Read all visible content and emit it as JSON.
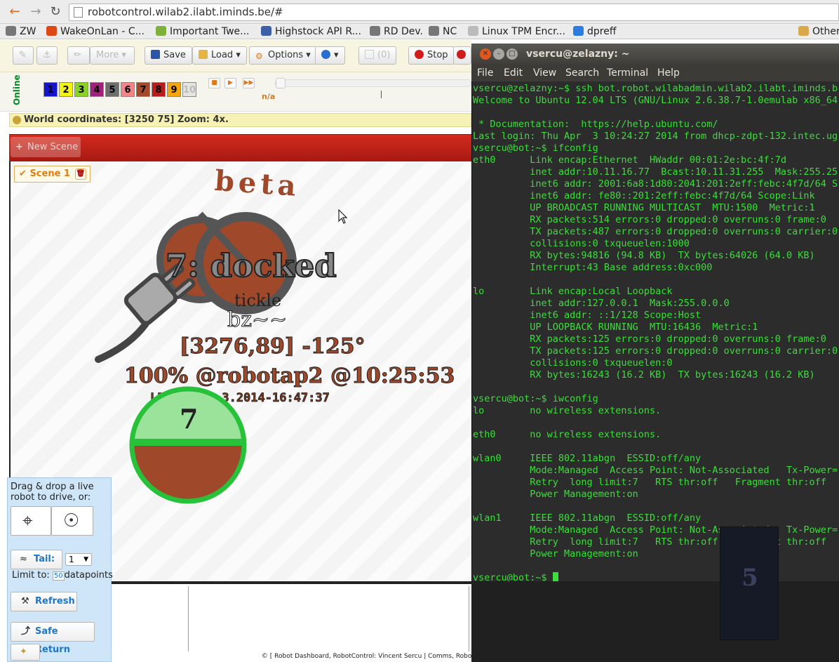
{
  "browser": {
    "url": "robotcontrol.wilab2.ilabt.iminds.be/#",
    "bookmarks": [
      {
        "label": "ZW",
        "color": "#777777"
      },
      {
        "label": "WakeOnLan - C...",
        "color": "#dd4814"
      },
      {
        "label": "Important Twe...",
        "color": "#7fb13a"
      },
      {
        "label": "Highstock API R...",
        "color": "#3c5fa8"
      },
      {
        "label": "RD Dev.",
        "color": "#777777"
      },
      {
        "label": "NC",
        "color": "#777777"
      },
      {
        "label": "Linux TPM Encr...",
        "color": "#bbbbbb"
      },
      {
        "label": "dpreff",
        "color": "#2a7de1"
      },
      {
        "label": "Other",
        "color": "#d9a84a"
      }
    ]
  },
  "toolbar": {
    "more": "More ▾",
    "save": "Save",
    "load": "Load ▾",
    "options": "Options ▾",
    "help": "▾",
    "count": "(0)",
    "stop": "Stop"
  },
  "online": {
    "label": "Online",
    "numbers": [
      {
        "n": "1",
        "bg": "#1414c8",
        "fg": "#000000"
      },
      {
        "n": "2",
        "bg": "#f2f214",
        "fg": "#000000"
      },
      {
        "n": "3",
        "bg": "#8ad126",
        "fg": "#000000"
      },
      {
        "n": "4",
        "bg": "#a0207a",
        "fg": "#000000"
      },
      {
        "n": "5",
        "bg": "#6d6d6d",
        "fg": "#000000"
      },
      {
        "n": "6",
        "bg": "#f28585",
        "fg": "#000000"
      },
      {
        "n": "7",
        "bg": "#a5492c",
        "fg": "#000000"
      },
      {
        "n": "8",
        "bg": "#b81c1c",
        "fg": "#000000"
      },
      {
        "n": "9",
        "bg": "#f5a50c",
        "fg": "#000000"
      },
      {
        "n": "10",
        "bg": "#e5e5df",
        "fg": "#bbbbbb"
      }
    ],
    "status": "n/a"
  },
  "coords": {
    "text": "World coordinates: [3250 75] Zoom: 4x."
  },
  "scene": {
    "new_scene": "New Scene",
    "tab": "Scene 1"
  },
  "robot": {
    "beta": "beta",
    "state": "7: docked",
    "tickle": "tickle",
    "bz": "bz~~",
    "position": "[3276,89]  -125°",
    "status": "100% @robotap2 @10:25:53",
    "lpe": "LPE v: 26.3.2014-16:47:37",
    "id": "7",
    "battery_pct": 100
  },
  "panel": {
    "drag_text": "Drag & drop a live robot to drive, or:",
    "tail": "Tail:",
    "tail_value": "1",
    "limit_prefix": "Limit to:",
    "limit_value": "50",
    "limit_suffix": "datapoints",
    "refresh": "Refresh",
    "safe_return": "Safe Return"
  },
  "footer": "© [ Robot Dashboard, RobotControl: Vincent Sercu | Comms, Robot Interface + LPE: Bart Jooris ]",
  "terminal": {
    "title": "vsercu@zelazny: ~",
    "menu": [
      "File",
      "Edit",
      "View",
      "Search",
      "Terminal",
      "Help"
    ],
    "lines": [
      "vsercu@zelazny:~$ ssh bot.robot.wilabadmin.wilab2.ilabt.iminds.b",
      "Welcome to Ubuntu 12.04 LTS (GNU/Linux 2.6.38.7-1.0emulab x86_64",
      "",
      " * Documentation:  https://help.ubuntu.com/",
      "Last login: Thu Apr  3 10:24:27 2014 from dhcp-zdpt-132.intec.ug",
      "vsercu@bot:~$ ifconfig",
      "eth0      Link encap:Ethernet  HWaddr 00:01:2e:bc:4f:7d",
      "          inet addr:10.11.16.77  Bcast:10.11.31.255  Mask:255.25",
      "          inet6 addr: 2001:6a8:1d80:2041:201:2eff:febc:4f7d/64 S",
      "          inet6 addr: fe80::201:2eff:febc:4f7d/64 Scope:Link",
      "          UP BROADCAST RUNNING MULTICAST  MTU:1500  Metric:1",
      "          RX packets:514 errors:0 dropped:0 overruns:0 frame:0",
      "          TX packets:487 errors:0 dropped:0 overruns:0 carrier:0",
      "          collisions:0 txqueuelen:1000",
      "          RX bytes:94816 (94.8 KB)  TX bytes:64026 (64.0 KB)",
      "          Interrupt:43 Base address:0xc000",
      "",
      "lo        Link encap:Local Loopback",
      "          inet addr:127.0.0.1  Mask:255.0.0.0",
      "          inet6 addr: ::1/128 Scope:Host",
      "          UP LOOPBACK RUNNING  MTU:16436  Metric:1",
      "          RX packets:125 errors:0 dropped:0 overruns:0 frame:0",
      "          TX packets:125 errors:0 dropped:0 overruns:0 carrier:0",
      "          collisions:0 txqueuelen:0",
      "          RX bytes:16243 (16.2 KB)  TX bytes:16243 (16.2 KB)",
      "",
      "vsercu@bot:~$ iwconfig",
      "lo        no wireless extensions.",
      "",
      "eth0      no wireless extensions.",
      "",
      "wlan0     IEEE 802.11abgn  ESSID:off/any",
      "          Mode:Managed  Access Point: Not-Associated   Tx-Power=",
      "          Retry  long limit:7   RTS thr:off   Fragment thr:off",
      "          Power Management:on",
      "",
      "wlan1     IEEE 802.11abgn  ESSID:off/any",
      "          Mode:Managed  Access Point: Not-Associated   Tx-Power=",
      "          Retry  long limit:7   RTS thr:off   Fragment thr:off",
      "          Power Management:on",
      "",
      "vsercu@bot:~$ "
    ],
    "ghost_robot": "5"
  },
  "colors": {
    "terminal_green": "#3bde3b",
    "robot_brown": "#a0482a",
    "battery_green": "#27c13a",
    "scene_red": "#c1221a"
  }
}
